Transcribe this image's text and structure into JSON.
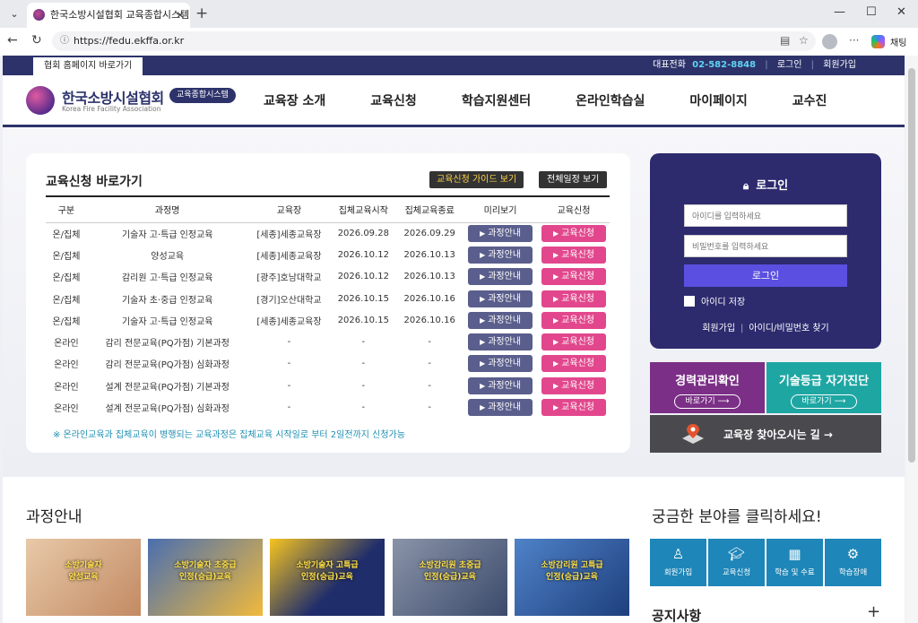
{
  "browser": {
    "tab_title": "한국소방시설협회 교육종합시스템",
    "url": "https://fedu.ekffa.or.kr",
    "chat_label": "채팅"
  },
  "topbar": {
    "homepage_link": "협회 홈페이지 바로가기",
    "phone_label": "대표전화",
    "phone": "02-582-8848",
    "login": "로그인",
    "signup": "회원가입"
  },
  "header": {
    "logo_title": "한국소방시설협회",
    "logo_sub": "Korea Fire Facility Association",
    "logo_badge": "교육종합시스템",
    "nav": [
      "교육장 소개",
      "교육신청",
      "학습지원센터",
      "온라인학습실",
      "마이페이지",
      "교수진"
    ]
  },
  "apply_panel": {
    "title": "교육신청 바로가기",
    "guide_button": "교육신청 가이드 보기",
    "schedule_button": "전체일정 보기",
    "columns": [
      "구분",
      "과정명",
      "교육장",
      "집체교육시작",
      "집체교육종료",
      "미리보기",
      "교육신청"
    ],
    "view_label": "과정안내",
    "apply_label": "교육신청",
    "rows": [
      {
        "type": "온/집체",
        "name": "기술자 고·특급 인정교육",
        "place": "[세종]세종교육장",
        "start": "2026.09.28",
        "end": "2026.09.29"
      },
      {
        "type": "온/집체",
        "name": "양성교육",
        "place": "[세종]세종교육장",
        "start": "2026.10.12",
        "end": "2026.10.13"
      },
      {
        "type": "온/집체",
        "name": "감리원 고·특급 인정교육",
        "place": "[광주]호남대학교",
        "start": "2026.10.12",
        "end": "2026.10.13"
      },
      {
        "type": "온/집체",
        "name": "기술자 초·중급 인정교육",
        "place": "[경기]오산대학교",
        "start": "2026.10.15",
        "end": "2026.10.16"
      },
      {
        "type": "온/집체",
        "name": "기술자 고·특급 인정교육",
        "place": "[세종]세종교육장",
        "start": "2026.10.15",
        "end": "2026.10.16"
      },
      {
        "type": "온라인",
        "name": "감리 전문교육(PQ가점) 기본과정",
        "place": "-",
        "start": "-",
        "end": "-"
      },
      {
        "type": "온라인",
        "name": "감리 전문교육(PQ가점) 심화과정",
        "place": "-",
        "start": "-",
        "end": "-"
      },
      {
        "type": "온라인",
        "name": "설계 전문교육(PQ가점) 기본과정",
        "place": "-",
        "start": "-",
        "end": "-"
      },
      {
        "type": "온라인",
        "name": "설계 전문교육(PQ가점) 심화과정",
        "place": "-",
        "start": "-",
        "end": "-"
      }
    ],
    "note": "※ 온라인교육과 집체교육이 병행되는 교육과정은 집체교육 시작일로 부터 2일전까지 신청가능"
  },
  "login": {
    "title": "로그인",
    "id_placeholder": "아이디를 입력하세요",
    "pw_placeholder": "비밀번호를 입력하세요",
    "button": "로그인",
    "save_id": "아이디 저장",
    "signup": "회원가입",
    "find": "아이디/비밀번호 찾기"
  },
  "quick": {
    "career_title": "경력관리확인",
    "career_button": "바로가기 ⟶",
    "tech_title": "기술등급 자가진단",
    "tech_button": "바로가기 ⟶",
    "map_label": "교육장 찾아오시는 길 →"
  },
  "courses": {
    "title": "과정안내",
    "cards": [
      "소방기술자\n양성교육",
      "소방기술자 초중급\n인정(승급)교육",
      "소방기술자 고특급\n인정(승급)교육",
      "소방감리원 초중급\n인정(승급)교육",
      "소방감리원 고특급\n인정(승급)교육"
    ]
  },
  "fields": {
    "title": "궁금한 분야를 클릭하세요!",
    "tiles": [
      {
        "label": "회원가입",
        "icon": "user-icon"
      },
      {
        "label": "교육신청",
        "icon": "graduation-cap-icon"
      },
      {
        "label": "학습 및 수료",
        "icon": "film-icon"
      },
      {
        "label": "학습장애",
        "icon": "gear-icon"
      }
    ]
  },
  "notice": {
    "title": "공지사항",
    "more": "+"
  },
  "colors": {
    "navy": "#2d336a",
    "accent_cyan": "#5fd3f3",
    "view_button": "#5a5e8c",
    "apply_button": "#e2478d",
    "career_bg": "#7b2f86",
    "tech_bg": "#1ea6a3",
    "tile_bg": "#1e86b8"
  }
}
